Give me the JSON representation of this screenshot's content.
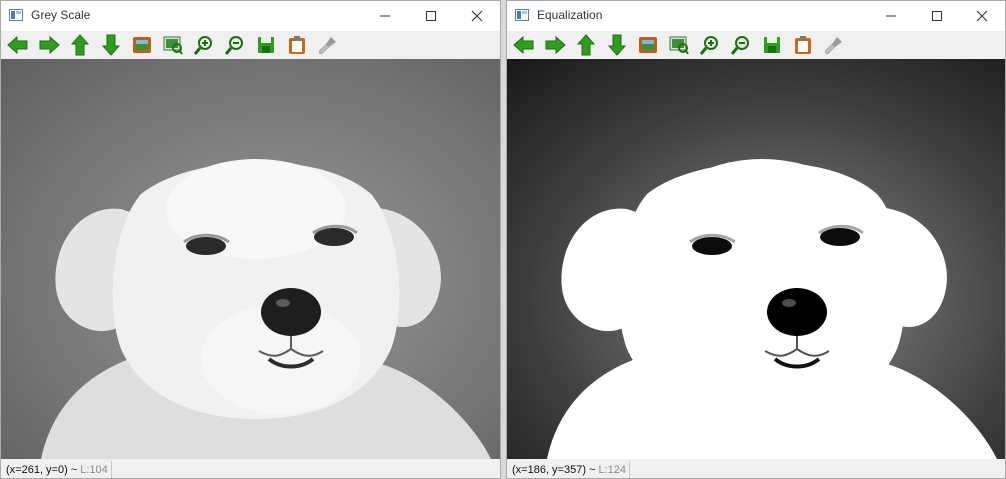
{
  "windows": [
    {
      "title": "Grey Scale",
      "status": {
        "coords": "(x=261, y=0) ~",
        "level": "L:104"
      }
    },
    {
      "title": "Equalization",
      "status": {
        "coords": "(x=186, y=357) ~",
        "level": "L:124"
      }
    }
  ],
  "toolbar_icons": [
    "arrow-left-icon",
    "arrow-right-icon",
    "arrow-up-icon",
    "arrow-down-icon",
    "zoom-fit-icon",
    "zoom-region-icon",
    "zoom-in-icon",
    "zoom-out-icon",
    "save-icon",
    "copy-icon",
    "properties-icon"
  ],
  "colors": {
    "arrow_green": "#2f9e1f",
    "icon_brown": "#b4631c",
    "titlebar_bg": "#ffffff",
    "toolbar_bg": "#f0f0f0"
  }
}
